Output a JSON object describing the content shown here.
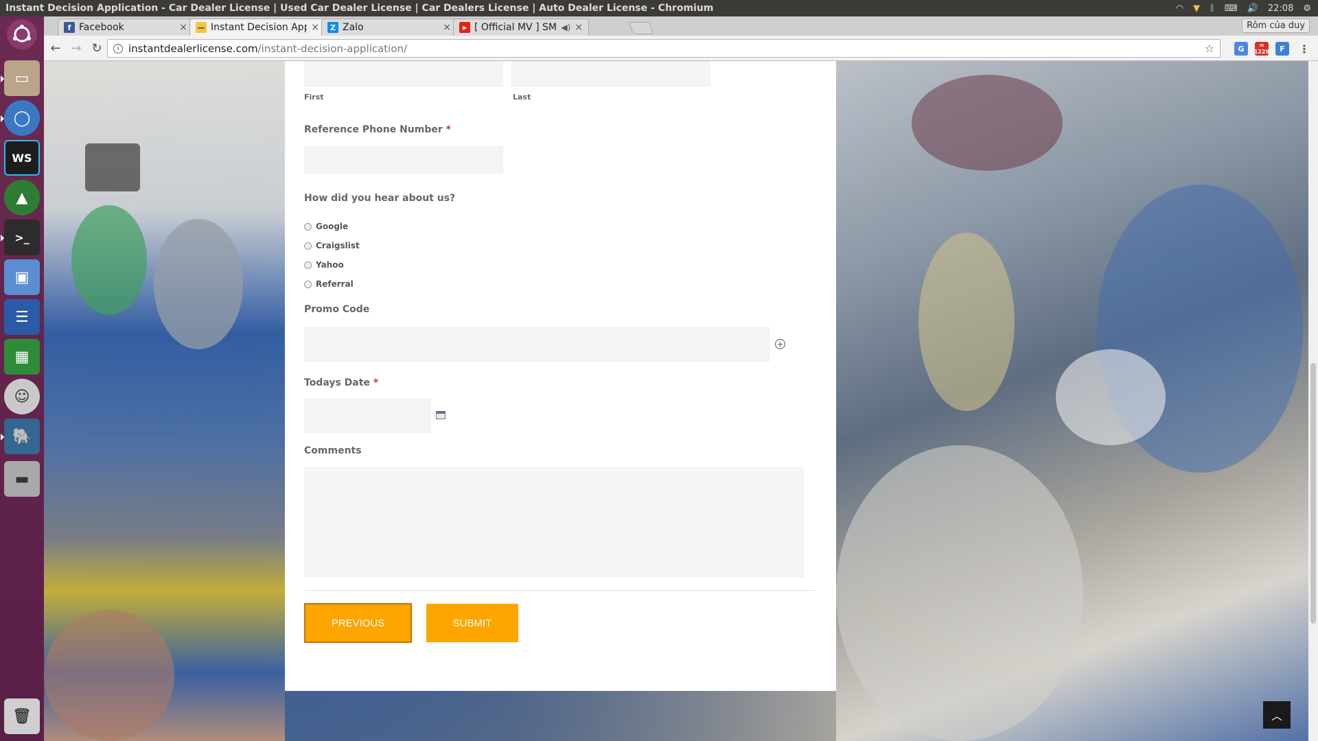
{
  "window": {
    "title": "Instant Decision Application - Car Dealer License | Used Car Dealer License | Car Dealers License | Auto Dealer License - Chromium",
    "clock": "22:08"
  },
  "launcher": {
    "items": [
      "ubuntu-icon",
      "files-icon",
      "chromium-icon",
      "webstorm-icon",
      "robomongo-icon",
      "terminal-icon",
      "virtualbox-icon",
      "writer-icon",
      "calc-icon",
      "smiley-icon",
      "postgres-icon",
      "drive-icon",
      "trash-icon"
    ]
  },
  "tabs": [
    {
      "label": "Facebook",
      "color": "#3b5998",
      "glyph": "f"
    },
    {
      "label": "Instant Decision App",
      "color": "#f5c842",
      "glyph": "—"
    },
    {
      "label": "Zalo",
      "color": "#0a8ee8",
      "glyph": "Z"
    },
    {
      "label": "[ Official MV ] SM",
      "color": "#e62117",
      "glyph": "▶"
    }
  ],
  "profile": "Rôm của duy",
  "address": {
    "host": "instantdealerlicense.com",
    "path": "/instant-decision-application/"
  },
  "extensions": {
    "badge": "1229"
  },
  "form": {
    "name_sublabels": {
      "first": "First",
      "last": "Last"
    },
    "ref_phone_label": "Reference Phone Number",
    "required_mark": "*",
    "hear_label": "How did you hear about us?",
    "hear_options": [
      "Google",
      "Craigslist",
      "Yahoo",
      "Referral"
    ],
    "promo_label": "Promo Code",
    "date_label": "Todays Date",
    "comments_label": "Comments",
    "prev_button": "PREVIOUS",
    "submit_button": "SUBMIT"
  },
  "colors": {
    "accent": "#ffa500",
    "required": "#c0392b",
    "launcher": "#5a1f47"
  }
}
